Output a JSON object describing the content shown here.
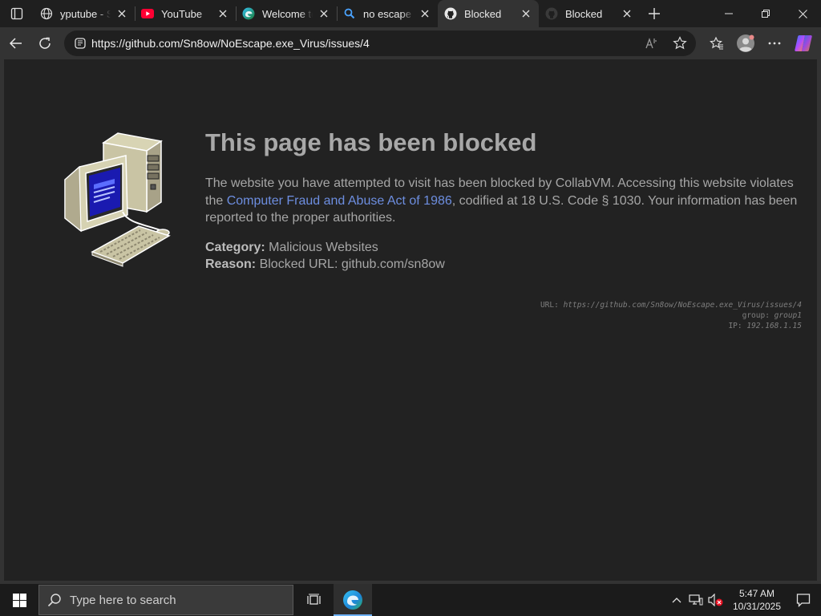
{
  "browser": {
    "tabs": [
      {
        "title": "yputube - Se",
        "icon": "globe-icon",
        "active": false
      },
      {
        "title": "YouTube",
        "icon": "youtube-icon",
        "active": false
      },
      {
        "title": "Welcome to",
        "icon": "edge-icon",
        "active": false
      },
      {
        "title": "no escape v",
        "icon": "search-icon",
        "active": false
      },
      {
        "title": "Blocked",
        "icon": "github-icon",
        "active": true
      },
      {
        "title": "Blocked",
        "icon": "github-icon",
        "active": false
      }
    ],
    "address_url": "https://github.com/Sn8ow/NoEscape.exe_Virus/issues/4"
  },
  "page": {
    "title": "This page has been blocked",
    "body_pre": "The website you have attempted to visit has been blocked by CollabVM. Accessing this website violates the ",
    "body_link": "Computer Fraud and Abuse Act of 1986",
    "body_post": ", codified at 18 U.S. Code § 1030. Your information has been reported to the proper authorities.",
    "category_label": "Category:",
    "category_value": "Malicious Websites",
    "reason_label": "Reason:",
    "reason_value": "Blocked URL: github.com/sn8ow",
    "tech_url_label": "URL:",
    "tech_url_value": "https://github.com/Sn8ow/NoEscape.exe_Virus/issues/4",
    "tech_group_label": "group:",
    "tech_group_value": "group1",
    "tech_ip_label": "IP:",
    "tech_ip_value": "192.168.1.15"
  },
  "taskbar": {
    "search_placeholder": "Type here to search",
    "time": "5:47 AM",
    "date": "10/31/2025"
  },
  "colors": {
    "link": "#6d8ee0",
    "youtube_red": "#ff0033",
    "accent": "#6fb3ff"
  }
}
